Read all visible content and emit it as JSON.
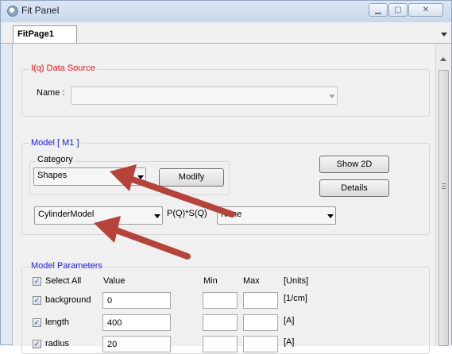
{
  "window": {
    "title": "Fit Panel",
    "controls": [
      "minimize",
      "maximize",
      "close"
    ]
  },
  "tabs": [
    {
      "label": "FitPage1",
      "active": true
    }
  ],
  "data_source": {
    "legend": "I(q) Data Source",
    "name_label": "Name :",
    "name_value": ""
  },
  "model": {
    "legend": "Model [ M1 ]",
    "category_label": "Category",
    "category_value": "Shapes",
    "modify_label": "Modify",
    "show2d_label": "Show 2D",
    "details_label": "Details",
    "model_value": "CylinderModel",
    "structure_label": "P(Q)*S(Q)",
    "structure_value": "None"
  },
  "params": {
    "legend": "Model Parameters",
    "headers": {
      "select_all": "Select All",
      "value": "Value",
      "min": "Min",
      "max": "Max",
      "units": "[Units]"
    },
    "rows": [
      {
        "name": "background",
        "value": "0",
        "unit": "[1/cm]",
        "checked": true
      },
      {
        "name": "length",
        "value": "400",
        "unit": "[A]",
        "checked": true
      },
      {
        "name": "radius",
        "value": "20",
        "unit": "[A]",
        "checked": true
      }
    ]
  },
  "annotation_color": "#b5433a",
  "colors": {
    "data_source_legend": "#e11b1b",
    "model_legend": "#1a1ae6"
  }
}
